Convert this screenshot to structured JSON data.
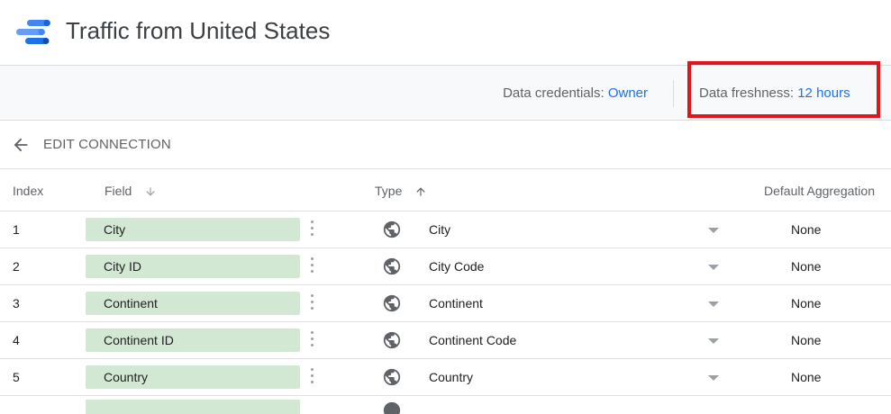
{
  "header": {
    "title": "Traffic from United States",
    "logo_icon": "data-studio-logo-icon"
  },
  "infobar": {
    "credentials_label": "Data credentials: ",
    "credentials_value": "Owner",
    "freshness_label": "Data freshness: ",
    "freshness_value": "12 hours",
    "highlight_color": "#e3151b"
  },
  "edit_connection": {
    "label": "EDIT CONNECTION",
    "back_icon": "arrow-back-icon"
  },
  "table": {
    "columns": {
      "index": "Index",
      "field": "Field",
      "type": "Type",
      "aggregation": "Default Aggregation"
    },
    "rows": [
      {
        "index": "1",
        "field": "City",
        "type": "City",
        "aggregation": "None"
      },
      {
        "index": "2",
        "field": "City ID",
        "type": "City Code",
        "aggregation": "None"
      },
      {
        "index": "3",
        "field": "Continent",
        "type": "Continent",
        "aggregation": "None"
      },
      {
        "index": "4",
        "field": "Continent ID",
        "type": "Continent Code",
        "aggregation": "None"
      },
      {
        "index": "5",
        "field": "Country",
        "type": "Country",
        "aggregation": "None"
      }
    ]
  },
  "colors": {
    "accent": "#1a73e8",
    "field_chip": "#d3e8d2"
  }
}
